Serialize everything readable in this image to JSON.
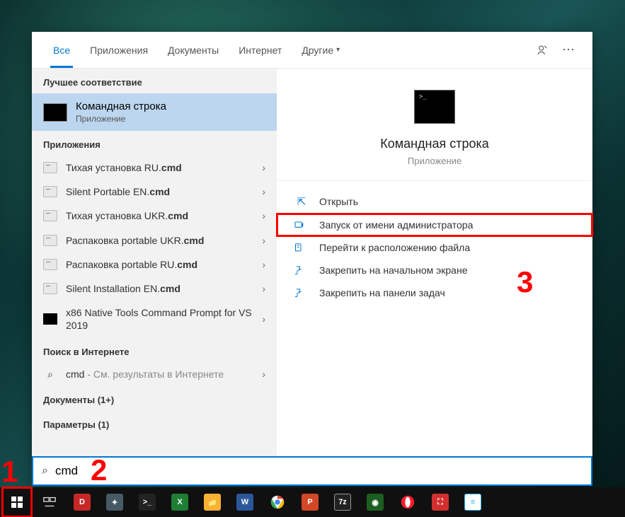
{
  "tabs": {
    "all": "Все",
    "apps": "Приложения",
    "docs": "Документы",
    "web": "Интернет",
    "other": "Другие"
  },
  "sections": {
    "best_match": "Лучшее соответствие",
    "apps": "Приложения",
    "web_search": "Поиск в Интернете",
    "documents": "Документы (1+)",
    "settings": "Параметры (1)"
  },
  "best_match_item": {
    "title": "Командная строка",
    "subtitle": "Приложение"
  },
  "app_items": [
    {
      "pre": "Тихая установка RU.",
      "bold": "cmd"
    },
    {
      "pre": "Silent Portable EN.",
      "bold": "cmd"
    },
    {
      "pre": "Тихая установка UKR.",
      "bold": "cmd"
    },
    {
      "pre": "Распаковка portable UKR.",
      "bold": "cmd"
    },
    {
      "pre": "Распаковка portable RU.",
      "bold": "cmd"
    },
    {
      "pre": "Silent Installation EN.",
      "bold": "cmd"
    },
    {
      "pre": "x86 Native Tools Command Prompt for VS 2019",
      "bold": "",
      "black_icon": true
    }
  ],
  "web_item": {
    "query": "cmd",
    "suffix": " - См. результаты в Интернете"
  },
  "preview": {
    "title": "Командная строка",
    "subtitle": "Приложение"
  },
  "actions": {
    "open": "Открыть",
    "run_admin": "Запуск от имени администратора",
    "open_location": "Перейти к расположению файла",
    "pin_start": "Закрепить на начальном экране",
    "pin_taskbar": "Закрепить на панели задач"
  },
  "search_value": "cmd",
  "annotations": {
    "a1": "1",
    "a2": "2",
    "a3": "3"
  }
}
